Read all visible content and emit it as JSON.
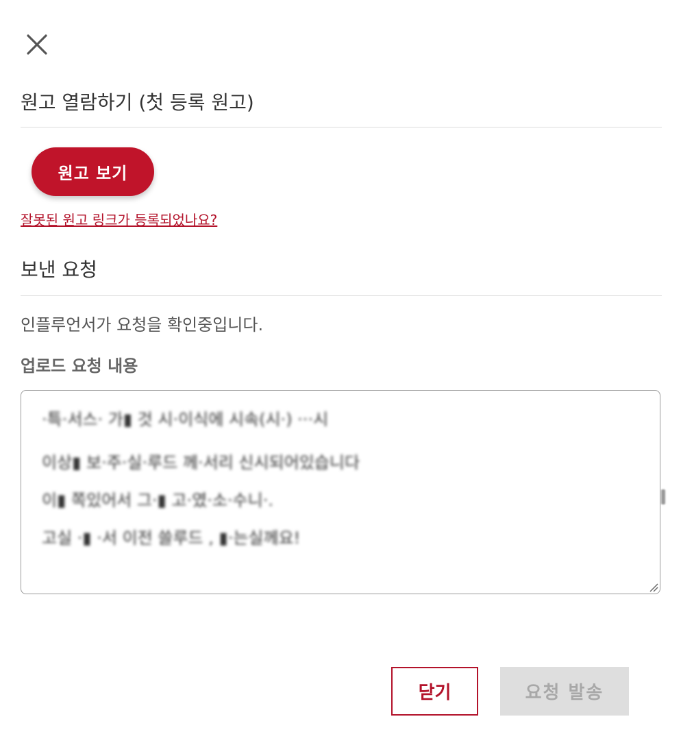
{
  "dialog": {
    "close_icon": "close-icon",
    "manuscript_section": {
      "title": "원고 열람하기 (첫 등록 원고)",
      "view_button_label": "원고 보기",
      "wrong_link_text": "잘못된 원고 링크가 등록되었나요?"
    },
    "request_section": {
      "title": "보낸 요청",
      "status_text": "인플루언서가 요청을 확인중입니다.",
      "upload_label": "업로드 요청 내용",
      "request_lines": [
        "·특·서스· 가▮ 것 시·이식에 시속(시·) ···시",
        "이상▮ 보·주·실·루드 께·서리 신시되어있습니다",
        "이▮ 쪽있어서 그·▮ 고·였·소·수니·.",
        "고실 ·▮ ·서 이전 쓸루드 , ▮·는실께요!"
      ]
    },
    "footer": {
      "close_button_label": "닫기",
      "send_button_label": "요청 발송"
    },
    "colors": {
      "accent": "#c0142a",
      "link": "#b3122a",
      "disabled_bg": "#dedede",
      "disabled_text": "#a8a8a8"
    }
  }
}
